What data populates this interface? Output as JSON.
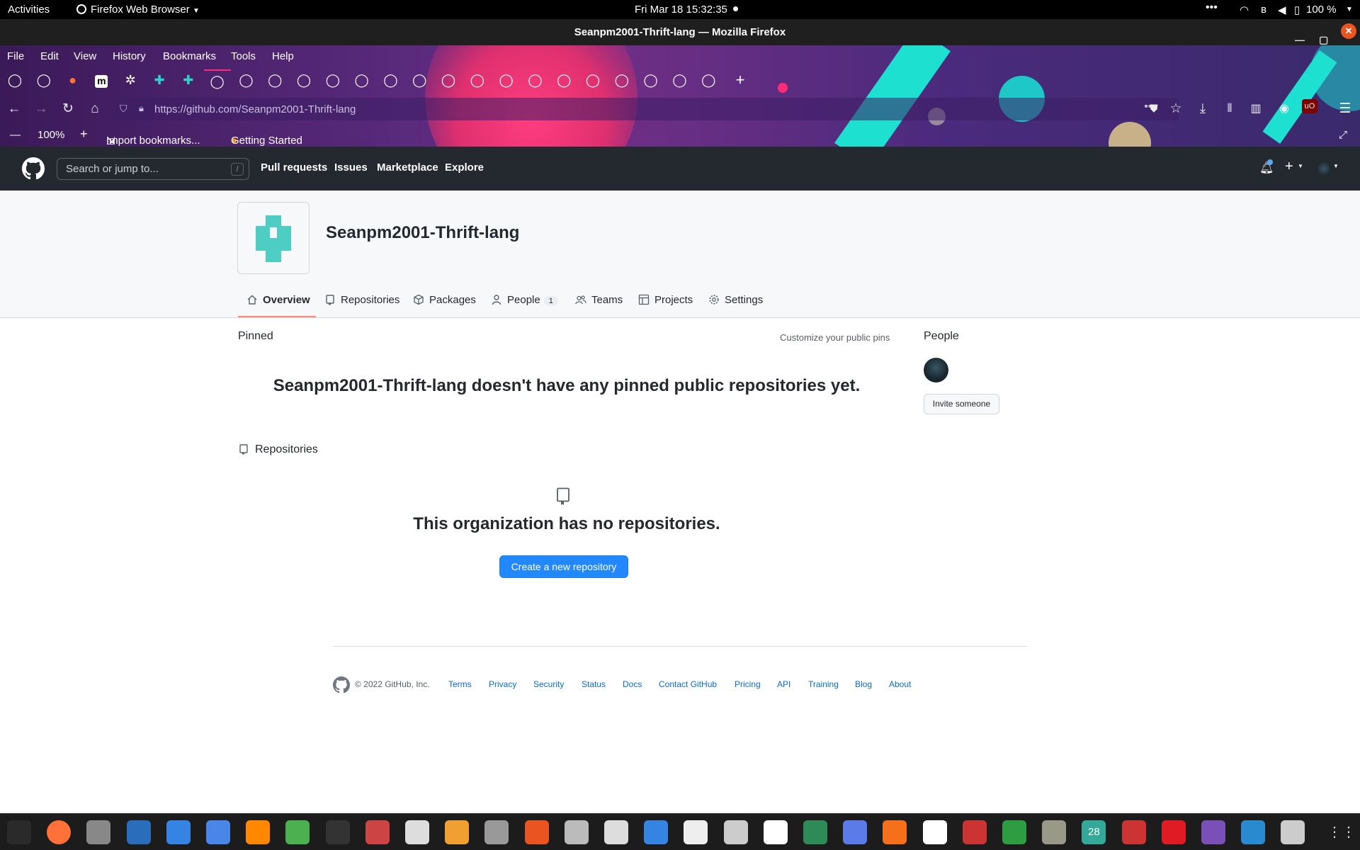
{
  "topbar": {
    "activities": "Activities",
    "app_name": "Firefox Web Browser",
    "clock": "Fri Mar 18  15:32:35",
    "battery": "100 %"
  },
  "window": {
    "title": "Seanpm2001-Thrift-lang — Mozilla Firefox"
  },
  "menubar": [
    "File",
    "Edit",
    "View",
    "History",
    "Bookmarks",
    "Tools",
    "Help"
  ],
  "tabs": {
    "count": 25,
    "new_tab_icon": "plus-icon",
    "icons": [
      "github-icon",
      "github-icon",
      "firefox-icon",
      "m-icon",
      "gear-icon",
      "teal-logo-icon",
      "teal-logo-icon",
      "github-icon",
      "github-icon",
      "github-icon",
      "github-icon",
      "github-icon",
      "github-icon",
      "github-icon",
      "github-icon",
      "github-icon",
      "github-icon",
      "github-icon",
      "github-icon",
      "github-icon",
      "github-icon",
      "github-icon",
      "github-icon",
      "github-icon",
      "github-icon"
    ]
  },
  "navbar": {
    "url": "https://github.com/Seanpm2001-Thrift-lang"
  },
  "bookmarks": {
    "zoom": "100%",
    "import": "Import bookmarks...",
    "getting_started": "Getting Started"
  },
  "github": {
    "search_placeholder": "Search or jump to...",
    "search_key": "/",
    "nav": [
      "Pull requests",
      "Issues",
      "Marketplace",
      "Explore"
    ]
  },
  "org": {
    "name": "Seanpm2001-Thrift-lang",
    "tabs": [
      {
        "label": "Overview",
        "icon": "home-icon",
        "active": true
      },
      {
        "label": "Repositories",
        "icon": "repo-icon"
      },
      {
        "label": "Packages",
        "icon": "package-icon"
      },
      {
        "label": "People",
        "icon": "person-icon",
        "counter": "1"
      },
      {
        "label": "Teams",
        "icon": "people-icon"
      },
      {
        "label": "Projects",
        "icon": "project-icon"
      },
      {
        "label": "Settings",
        "icon": "gear-icon"
      }
    ]
  },
  "main": {
    "pinned_heading": "Pinned",
    "customize_pins": "Customize your public pins",
    "no_pinned": "Seanpm2001-Thrift-lang doesn't have any pinned public repositories yet.",
    "people_heading": "People",
    "invite_button": "Invite someone",
    "repos_heading": "Repositories",
    "no_repos": "This organization has no repositories.",
    "create_button": "Create a new repository"
  },
  "footer": {
    "copyright": "© 2022 GitHub, Inc.",
    "links": [
      "Terms",
      "Privacy",
      "Security",
      "Status",
      "Docs",
      "Contact GitHub",
      "Pricing",
      "API",
      "Training",
      "Blog",
      "About"
    ]
  },
  "dock": {
    "calendar_day": "28"
  },
  "colors": {
    "github_header": "#24292f",
    "primary_button": "#2188ff",
    "link": "#0969da",
    "active_tab_underline": "#fd8c73",
    "org_logo": "#4ecdc4"
  }
}
